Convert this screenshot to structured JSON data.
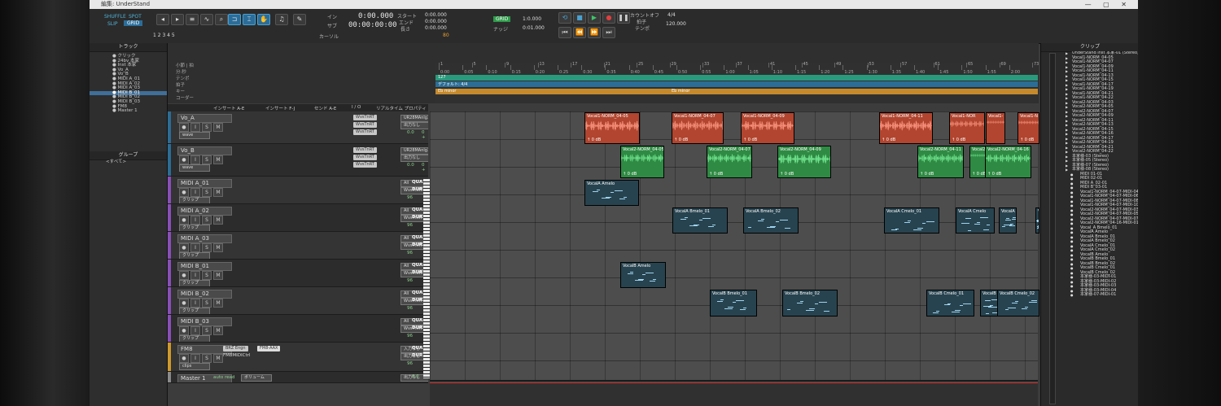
{
  "window": {
    "title": "編集: UnderStand",
    "controls": "—  ▢  ✕"
  },
  "toolbar": {
    "modes": [
      "SHUFFLE",
      "SPOT",
      "SLIP",
      "GRID"
    ],
    "grid_nums": "1 2 3 4 5",
    "main_counter": "0:00.000",
    "sub_counter": "00:00:00:00",
    "labels": {
      "in": "イン",
      "out": "サブ",
      "cursor": "カーソル",
      "start": "スタート",
      "end": "エンド",
      "length": "長さ",
      "nudge": "ナッジ",
      "count_in": "カウントオフ",
      "meter": "拍子",
      "tempo": "テンポ"
    },
    "start_val": "0:00.000",
    "end_val": "0:00.000",
    "length_val": "0:00.000",
    "grid_val": "1:0.000",
    "nudge_val": "0:01.000",
    "meter_val": "4/4",
    "tempo_val": "120.000",
    "dly": "80"
  },
  "track_list": {
    "header": "トラック",
    "items": [
      "クリック",
      "24bv 本家",
      "Inst 本家",
      "Vo_A",
      "Vo_B",
      "MIDI A_01",
      "MIDI A_02",
      "MIDI A_03",
      "MIDI B_01",
      "MIDI B_02",
      "MIDI B_03",
      "FM8",
      "Master 1"
    ],
    "selected_index": 8,
    "groups_header": "グループ",
    "groups_item": "<すべて>"
  },
  "ruler_labels": [
    "小節 | 拍",
    "分:秒",
    "テンポ",
    "拍子",
    "キー",
    "コーダー"
  ],
  "timeline": {
    "bars": [
      "1",
      "5",
      "9",
      "13",
      "17",
      "21",
      "25",
      "29",
      "33",
      "37",
      "41",
      "45",
      "49",
      "53",
      "57",
      "61",
      "65",
      "69",
      "73"
    ],
    "times": [
      "0:00",
      "0:05",
      "0:10",
      "0:15",
      "0:20",
      "0:25",
      "0:30",
      "0:35",
      "0:40",
      "0:45",
      "0:50",
      "0:55",
      "1:00",
      "1:05",
      "1:10",
      "1:15",
      "1:20",
      "1:25",
      "1:30",
      "1:35",
      "1:40",
      "1:45",
      "1:50",
      "1:55",
      "2:00"
    ],
    "tempo_lane": "127",
    "meter_lane": "デフォルト: 4/4",
    "key_lane": "Eb minor",
    "key_lane2": "Eb minor"
  },
  "mix_headers": [
    "インサート A-E",
    "インサート F-J",
    "センド A-E",
    "I / O",
    "リアルタイム プロパティ"
  ],
  "tracks": [
    {
      "name": "Vo_A",
      "inserts": [
        "WvsTnRT",
        "WvsTnRT",
        "WvsTnRT"
      ],
      "io_in": "UR28MAnlg3+4",
      "io_out": "出力なし",
      "vol": "0.0",
      "pan": "0 +",
      "mode": "wave"
    },
    {
      "name": "Vo_B",
      "inserts": [
        "WvsTnRT",
        "WvsTnRT",
        "WvsTnRT"
      ],
      "io_in": "UR28MAnlg3+4",
      "io_out": "出力なし",
      "vol": "0.0",
      "pan": "0 +",
      "mode": "wave"
    },
    {
      "name": "MIDI A_01",
      "io_in": "All",
      "io_out": "WvsTnRT-Tm01",
      "vol": "96",
      "rt1": "QUA",
      "rt2": "DUR",
      "mode": "クリップ"
    },
    {
      "name": "MIDI A_02",
      "io_in": "All",
      "io_out": "WvsTnRT-Tm21",
      "vol": "96",
      "rt1": "QUA",
      "rt2": "DUR",
      "mode": "クリップ"
    },
    {
      "name": "MIDI A_03",
      "io_in": "All",
      "io_out": "WvsTnRT-Tm31",
      "vol": "96",
      "rt1": "QUA",
      "rt2": "DUR",
      "mode": "クリップ"
    },
    {
      "name": "MIDI B_01",
      "io_in": "All",
      "io_out": "WvsTnRT-Tm01",
      "vol": "96",
      "rt1": "QUA",
      "rt2": "DUR",
      "mode": "クリップ"
    },
    {
      "name": "MIDI B_02",
      "io_in": "All",
      "io_out": "WvsTnRT-Tm61",
      "vol": "96",
      "rt1": "QUA",
      "rt2": "DUR",
      "mode": "クリップ"
    },
    {
      "name": "MIDI B_03",
      "io_in": "All",
      "io_out": "WvsTnRT-Tm71",
      "vol": "96",
      "rt1": "QUA",
      "rt2": "DUR",
      "mode": "クリップ"
    },
    {
      "name": "FM8",
      "inserts": [
        "BRZ Engn"
      ],
      "insert2": "FM8-AAX",
      "insert3": "FM8MIDICtrl",
      "io_in": "入力なし",
      "io_out": "出力なし",
      "vol": "96",
      "rt1": "QUA",
      "rt2": "DUR",
      "mode": "clips"
    },
    {
      "name": "Master 1",
      "io_out": "出力なし",
      "vol": "0.0",
      "mode": "ボリューム",
      "mode2": "auto read"
    }
  ],
  "clips": {
    "vo_a": [
      {
        "label": "Vocal1-NORM_04-05",
        "db": "0 dB"
      },
      {
        "label": "Vocal1-NORM_04-07",
        "db": "0 dB"
      },
      {
        "label": "Vocal1-NORM_04-09",
        "db": "0 dB"
      },
      {
        "label": "Vocal1-NORM_04-11",
        "db": "0 dB"
      },
      {
        "label": "Vocal1-NOR",
        "db": "0 dB"
      },
      {
        "label": "Vocal1-",
        "db": ""
      },
      {
        "label": "Vocal1-N",
        "db": "0 dB"
      }
    ],
    "vo_b": [
      {
        "label": "Vocal2-NORM_04-05",
        "db": "0 dB"
      },
      {
        "label": "Vocal2-NORM_04-07",
        "db": "0 dB"
      },
      {
        "label": "Vocal2-NORM_04-09",
        "db": "0 dB"
      },
      {
        "label": "Vocal2-NORM_04-11",
        "db": "0 dB"
      },
      {
        "label": "Vocal2-NO",
        "db": "0 dB"
      },
      {
        "label": "Vocal2-NORM_04-16",
        "db": "0 dB"
      }
    ],
    "midi_a01": [
      {
        "label": "VocalA Amelo"
      }
    ],
    "midi_a02": [
      {
        "label": "VocalA Bmelo_01"
      },
      {
        "label": "VocalA Bmelo_02"
      },
      {
        "label": "VocalA Cmelo_01"
      },
      {
        "label": "VocalA Cmelo"
      },
      {
        "label": "VocalA"
      },
      {
        "label": "Voca"
      }
    ],
    "midi_b01": [
      {
        "label": "VocalB Amelo"
      }
    ],
    "midi_b02": [
      {
        "label": "VocalB Bmelo_01"
      },
      {
        "label": "VocalB Bmelo_02"
      },
      {
        "label": "VocalB Cmelo_01"
      },
      {
        "label": "VocalB"
      },
      {
        "label": "VocalB Cmelo_02"
      }
    ]
  },
  "clips_panel": {
    "header": "クリップ",
    "items": [
      "UnderStand Inst 本家-01 (Stereo)",
      "Vocal1-NORM_04-05",
      "Vocal1-NORM_04-07",
      "Vocal1-NORM_04-09",
      "Vocal1-NORM_04-11",
      "Vocal1-NORM_04-13",
      "Vocal1-NORM_04-15",
      "Vocal1-NORM_04-17",
      "Vocal1-NORM_04-19",
      "Vocal1-NORM_04-21",
      "Vocal1-NORM_04-22",
      "Vocal2-NORM_04-03",
      "Vocal2-NORM_04-05",
      "Vocal2-NORM_04-07",
      "Vocal2-NORM_04-09",
      "Vocal2-NORM_04-11",
      "Vocal2-NORM_04-13",
      "Vocal2-NORM_04-15",
      "Vocal2-NORM_04-16",
      "Vocal2-NORM_04-17",
      "Vocal2-NORM_04-19",
      "Vocal2-NORM_04-21",
      "Vocal2-NORM_04-22",
      "本家様-03 (Stereo)",
      "本家様-05 (Stereo)",
      "本家様-07 (Stereo)",
      "本家様-08 (Stereo)"
    ],
    "midi_items": [
      "MIDI 01-01",
      "MIDI 02-01",
      "MIDI A_02-01",
      "MIDI B_03-01",
      "Vocal1-NORM_04-07-MIDI-04",
      "Vocal1-NORM_04-07-MIDI-06",
      "Vocal1-NORM_04-07-MIDI-08",
      "Vocal1-NORM_04-07-MIDI-10",
      "Vocal2-NORM_04-07-MIDI-03",
      "Vocal2-NORM_04-07-MIDI-05",
      "Vocal2-NORM_04-07-MIDI-07",
      "Vocal2-NORM_04-16-MIDI-01",
      "Vocal_A Bmelo_01",
      "VocalA Amelo",
      "VocalA Bmelo_01",
      "VocalA Bmelo_02",
      "VocalA Cmelo_01",
      "VocalA Cmelo_02",
      "VocalB Amelo",
      "VocalB Bmelo_01",
      "VocalB Bmelo_02",
      "VocalB Cmelo_01",
      "VocalB Cmelo_02",
      "本家様-03-MIDI-01",
      "本家様-03-MIDI-02",
      "本家様-03-MIDI-03",
      "本家様-03-MIDI-04",
      "本家様-07-MIDI-01"
    ]
  },
  "colors": {
    "vocal_a": "#b1452f",
    "vocal_b": "#2f8a43",
    "midi_clip": "#27434f",
    "tempo_lane": "#2a9a7c",
    "meter_lane": "#2c6d95",
    "key_lane": "#c58a2c",
    "accent": "#4aa0d0"
  }
}
